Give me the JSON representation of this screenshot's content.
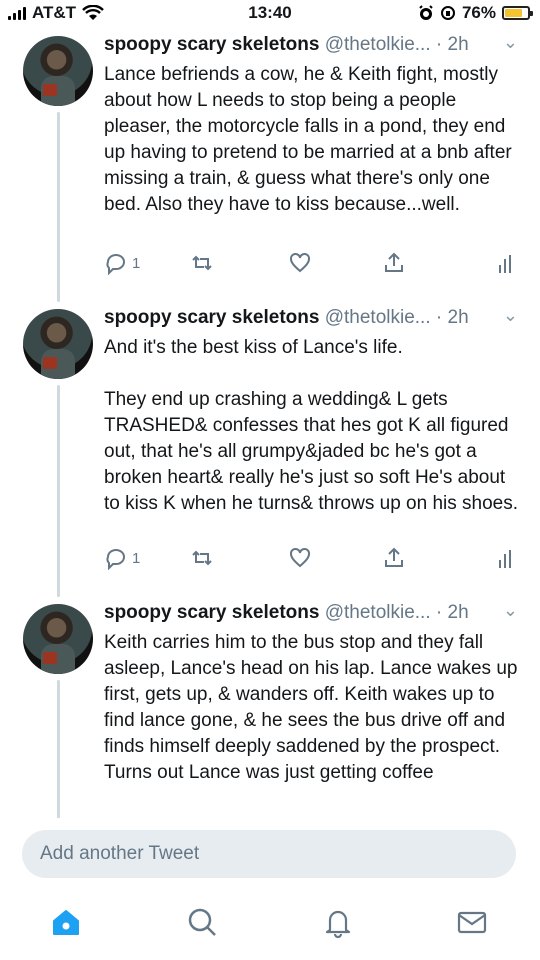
{
  "status_bar": {
    "carrier": "AT&T",
    "time": "13:40",
    "battery": "76%",
    "battery_level": 0.76,
    "icons": [
      "signal-icon",
      "wifi-icon",
      "alarm-icon",
      "orientation-lock-icon",
      "battery-icon"
    ]
  },
  "tweets": [
    {
      "name": "spoopy scary skeletons",
      "handle": "@thetolkie...",
      "dot": "·",
      "time": "2h",
      "text": "Lance befriends a cow, he & Keith fight, mostly about how L needs to stop being a people pleaser, the motorcycle falls in a pond, they end up having to pretend to be married at a bnb after missing a train, & guess what there's only one bed. Also they have to kiss because...well.",
      "reply_count": "1"
    },
    {
      "name": "spoopy scary skeletons",
      "handle": "@thetolkie...",
      "dot": "·",
      "time": "2h",
      "text": "And it's the best kiss of Lance's life.\n\nThey end up crashing a wedding& L gets TRASHED& confesses that hes got K all figured out, that he's all grumpy&jaded bc he's got a broken heart& really he's just so soft He's about to kiss K when he turns& throws up on his shoes.",
      "reply_count": "1"
    },
    {
      "name": "spoopy scary skeletons",
      "handle": "@thetolkie...",
      "dot": "·",
      "time": "2h",
      "text": "Keith carries him to the bus stop and they fall asleep, Lance's head on his lap. Lance wakes up first, gets up, & wanders off. Keith wakes up to find lance gone, & he sees the bus drive off and finds himself deeply saddened by the prospect. Turns out Lance was just getting coffee",
      "reply_count": ""
    }
  ],
  "composer": {
    "placeholder": "Add another Tweet"
  },
  "tabbar": {
    "items": [
      "home-icon",
      "search-icon",
      "notifications-icon",
      "messages-icon"
    ],
    "active": "home-icon",
    "accent": "#1da1f2"
  },
  "colors": {
    "text": "#14171a",
    "secondary": "#657786",
    "line": "#cfd9de",
    "composer_bg": "#e6ecf0"
  }
}
